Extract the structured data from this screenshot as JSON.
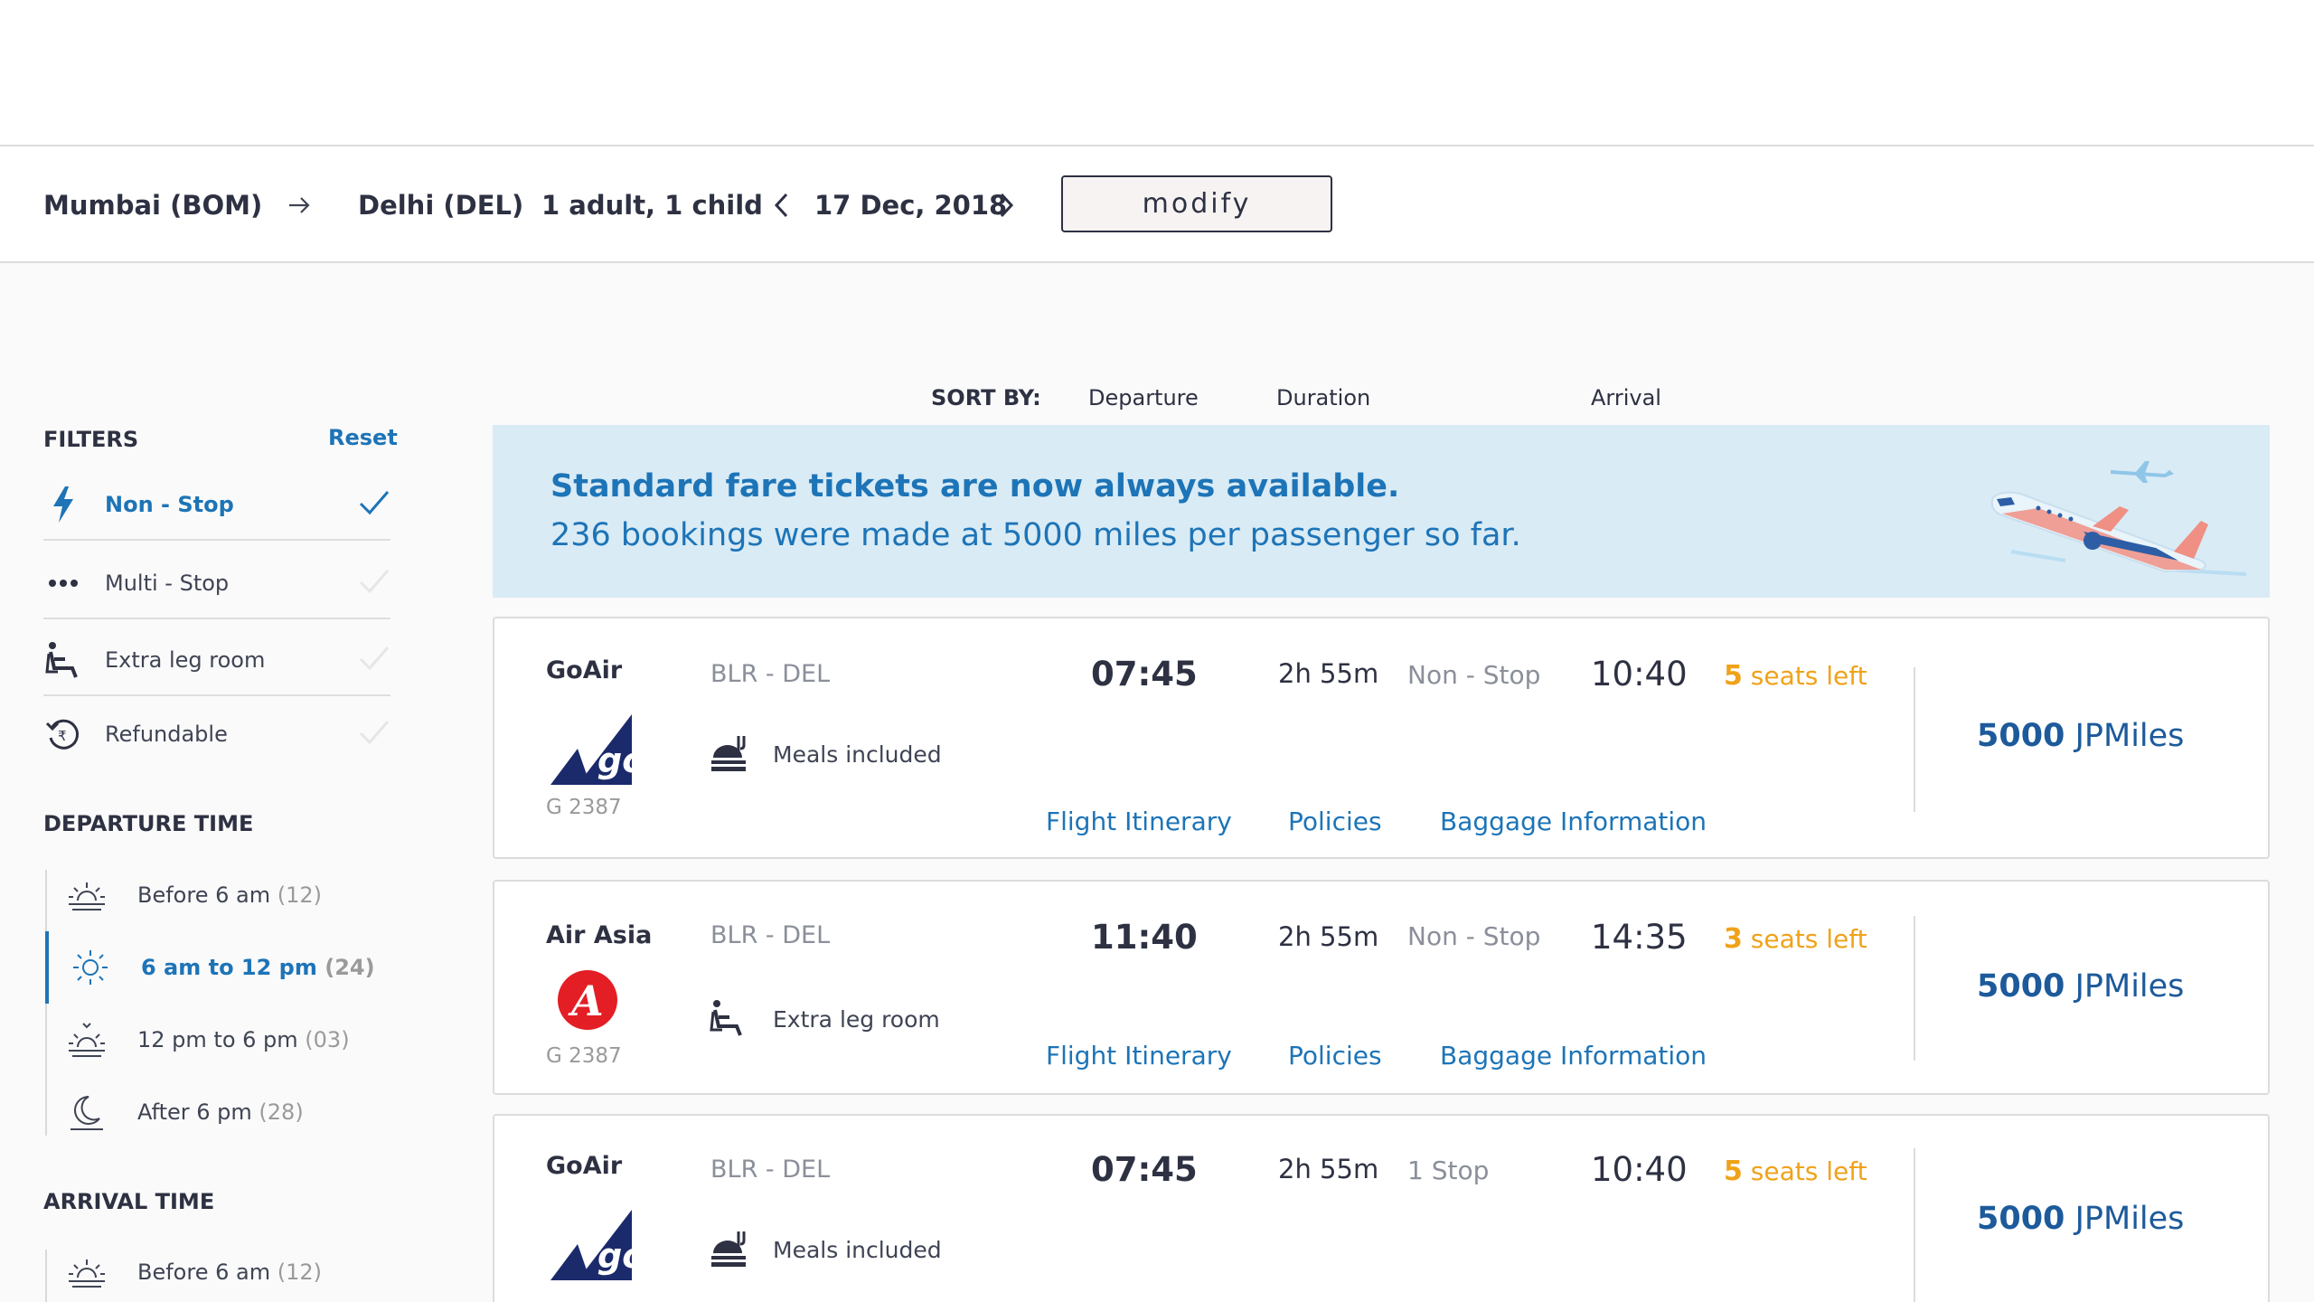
{
  "search": {
    "from": "Mumbai (BOM)",
    "to": "Delhi (DEL)",
    "passengers": "1 adult, 1 child",
    "date": "17 Dec, 2018",
    "modify_label": "modify"
  },
  "sort": {
    "label": "SORT BY:",
    "options": [
      "Departure",
      "Duration",
      "Arrival"
    ]
  },
  "filters": {
    "title": "FILTERS",
    "reset_label": "Reset",
    "items": [
      {
        "label": "Non - Stop",
        "icon": "lightning-icon",
        "active": true
      },
      {
        "label": "Multi - Stop",
        "icon": "dots-icon",
        "active": false
      },
      {
        "label": "Extra leg room",
        "icon": "seat-icon",
        "active": false
      },
      {
        "label": "Refundable",
        "icon": "refund-icon",
        "active": false
      }
    ]
  },
  "departure_time": {
    "title": "DEPARTURE TIME",
    "items": [
      {
        "label": "Before 6 am",
        "count": "(12)",
        "icon": "sunrise-icon",
        "active": false
      },
      {
        "label": "6 am to 12 pm",
        "count": "(24)",
        "icon": "sun-icon",
        "active": true
      },
      {
        "label": "12 pm to 6 pm",
        "count": "(03)",
        "icon": "sunset-icon",
        "active": false
      },
      {
        "label": "After 6 pm",
        "count": "(28)",
        "icon": "moon-icon",
        "active": false
      }
    ]
  },
  "arrival_time": {
    "title": "ARRIVAL TIME",
    "items": [
      {
        "label": "Before 6 am",
        "count": "(12)",
        "icon": "sunrise-icon"
      }
    ]
  },
  "banner": {
    "headline": "Standard fare tickets are now always available.",
    "subline": "236 bookings were made at 5000 miles per passenger so far."
  },
  "flights": [
    {
      "airline": "GoAir",
      "code": "G 2387",
      "route": "BLR - DEL",
      "amenity": "Meals included",
      "amenity_icon": "meal-icon",
      "departure": "07:45",
      "duration": "2h 55m",
      "stops": "Non - Stop",
      "arrival": "10:40",
      "seats_num": "5",
      "seats_text": "seats left",
      "price_num": "5000",
      "price_unit": "JPMiles"
    },
    {
      "airline": "Air Asia",
      "code": "G 2387",
      "route": "BLR - DEL",
      "amenity": "Extra leg room",
      "amenity_icon": "seat-icon",
      "departure": "11:40",
      "duration": "2h 55m",
      "stops": "Non - Stop",
      "arrival": "14:35",
      "seats_num": "3",
      "seats_text": "seats left",
      "price_num": "5000",
      "price_unit": "JPMiles"
    },
    {
      "airline": "GoAir",
      "code": "",
      "route": "BLR - DEL",
      "amenity": "Meals included",
      "amenity_icon": "meal-icon",
      "departure": "07:45",
      "duration": "2h 55m",
      "stops": "1 Stop",
      "arrival": "10:40",
      "seats_num": "5",
      "seats_text": "seats left",
      "price_num": "5000",
      "price_unit": "JPMiles"
    }
  ],
  "links": {
    "itinerary": "Flight Itinerary",
    "policies": "Policies",
    "baggage": "Baggage Information"
  },
  "colors": {
    "accent": "#1d74b7",
    "seats": "#f0a219",
    "banner_bg": "#d9ebf5",
    "price": "#1d5a9b"
  }
}
